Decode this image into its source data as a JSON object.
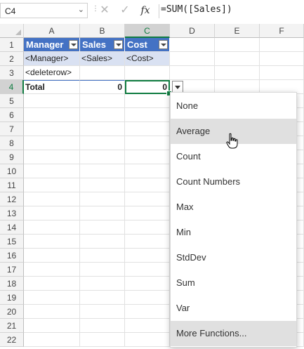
{
  "formula_bar": {
    "name_box": "C4",
    "formula": "=SUM([Sales])",
    "cancel_icon": "✕",
    "enter_icon": "✓",
    "fx_label": "fx"
  },
  "columns": [
    "A",
    "B",
    "C",
    "D",
    "E",
    "F"
  ],
  "rows": [
    "1",
    "2",
    "3",
    "4",
    "5",
    "6",
    "7",
    "8",
    "9",
    "10",
    "11",
    "12",
    "13",
    "14",
    "15",
    "16",
    "17",
    "18",
    "19",
    "20",
    "21",
    "22"
  ],
  "table": {
    "headers": [
      "Manager",
      "Sales",
      "Cost"
    ],
    "row2": [
      "<Manager>",
      "<Sales>",
      "<Cost>"
    ],
    "row3": "<deleterow>",
    "total_label": "Total",
    "total_sales": "0",
    "total_cost": "0"
  },
  "menu": {
    "items": [
      "None",
      "Average",
      "Count",
      "Count Numbers",
      "Max",
      "Min",
      "StdDev",
      "Sum",
      "Var",
      "More Functions..."
    ],
    "highlighted": [
      "Average",
      "More Functions..."
    ]
  },
  "colors": {
    "table_header": "#4472c4",
    "table_band": "#d9e1f2",
    "selection": "#107c41"
  }
}
